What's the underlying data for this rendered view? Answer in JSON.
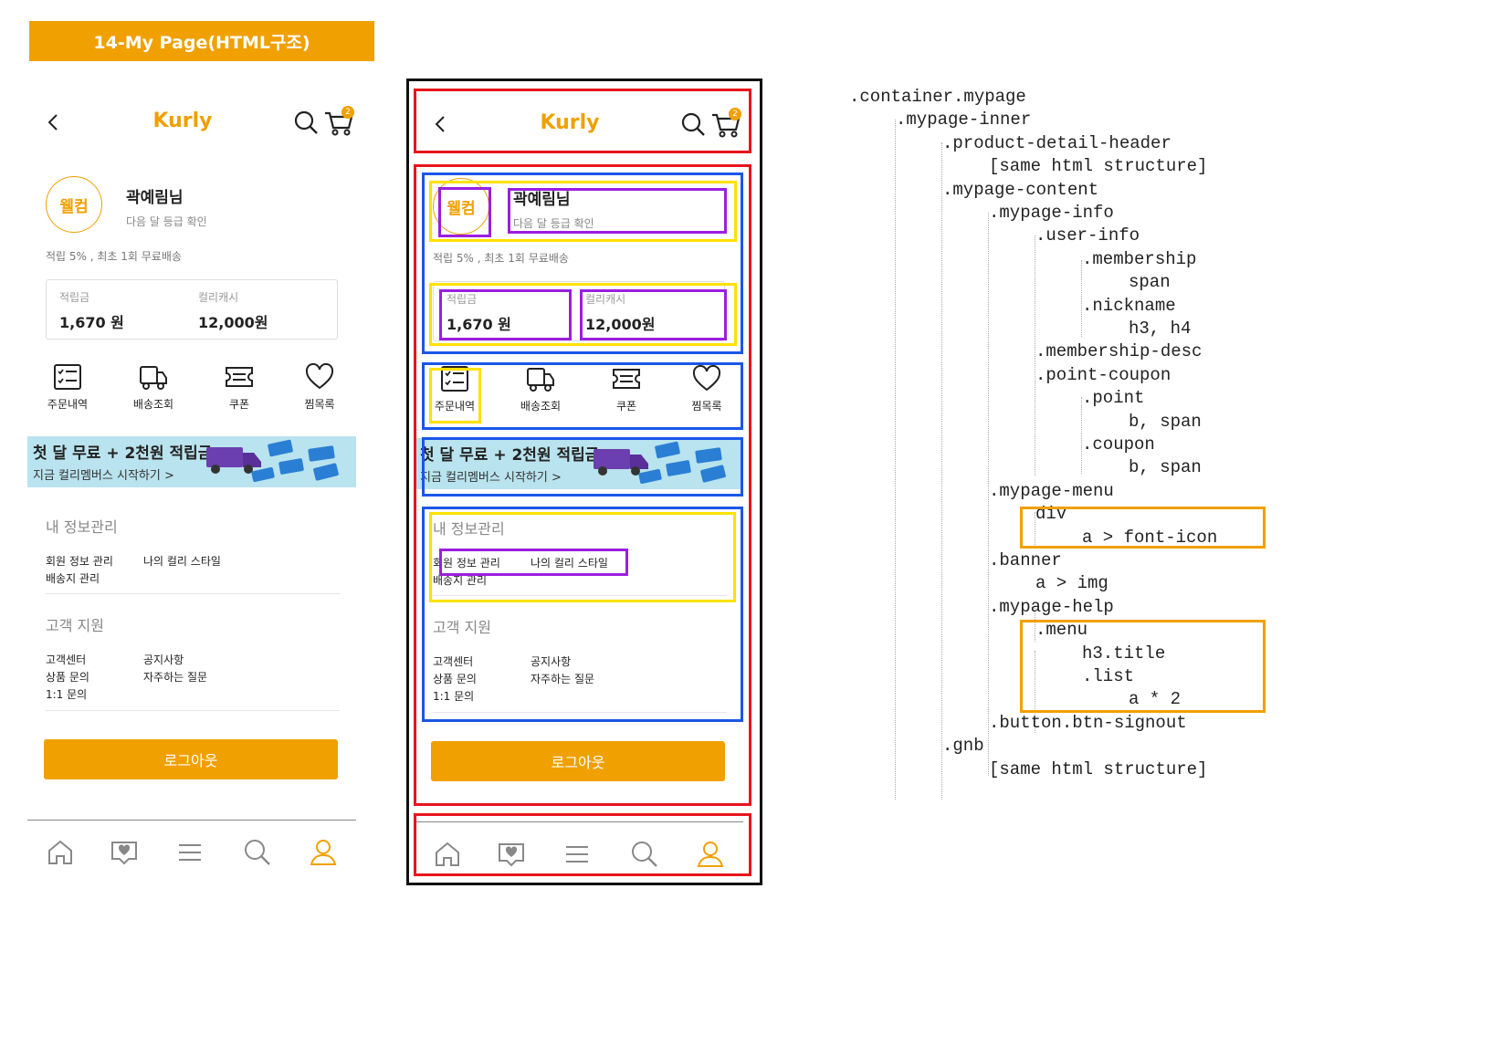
{
  "title": "14-My Page(HTML구조)",
  "phone": {
    "logo": "Kurly",
    "cart_count": "2",
    "membership": "웰컴",
    "nickname": "곽예림님",
    "grade_link": "다음 달 등급 확인",
    "membership_desc": "적립 5% , 최초 1회 무료배송",
    "point_label": "적립금",
    "point_value": "1,670 원",
    "coupon_label": "컬리캐시",
    "coupon_value": "12,000원",
    "menu": [
      "주문내역",
      "배송조회",
      "쿠폰",
      "찜목록"
    ],
    "banner_title": "첫 달 무료 + 2천원 적립금",
    "banner_sub": "지금 컬리멤버스 시작하기 >",
    "section1_title": "내 정보관리",
    "section1_links": [
      "회원 정보 관리",
      "나의 컬리 스타일",
      "배송지 관리"
    ],
    "section2_title": "고객 지원",
    "section2_links": [
      "고객센터",
      "공지사항",
      "상품 문의",
      "자주하는 질문",
      "1:1 문의"
    ],
    "logout": "로그아웃"
  },
  "icons": {
    "back": "chevron-left-icon",
    "search": "search-icon",
    "cart": "cart-icon",
    "order": "checklist-icon",
    "delivery": "truck-icon",
    "coupon": "ticket-icon",
    "wish": "heart-icon",
    "home": "home-icon",
    "category": "heart-chat-icon",
    "menu": "hamburger-icon",
    "gnb_search": "search-icon",
    "mypage": "user-icon"
  },
  "colors": {
    "accent": "#f0a000",
    "header_box": "#e8141c",
    "section_box": "#1a56e8",
    "group_box": "#ffe100",
    "item_box": "#9b1ee0",
    "code_box": "#f0a000"
  },
  "tree": [
    ".container.mypage",
    ".mypage-inner",
    ".product-detail-header",
    "[same html structure]",
    ".mypage-content",
    ".mypage-info",
    ".user-info",
    ".membership",
    "span",
    ".nickname",
    "h3, h4",
    ".membership-desc",
    ".point-coupon",
    ".point",
    "b, span",
    ".coupon",
    "b, span",
    ".mypage-menu",
    "div",
    "a > font-icon",
    ".banner",
    "a > img",
    ".mypage-help",
    ".menu",
    "h3.title",
    ".list",
    "a * 2",
    ".button.btn-signout",
    ".gnb",
    "[same html structure]"
  ]
}
